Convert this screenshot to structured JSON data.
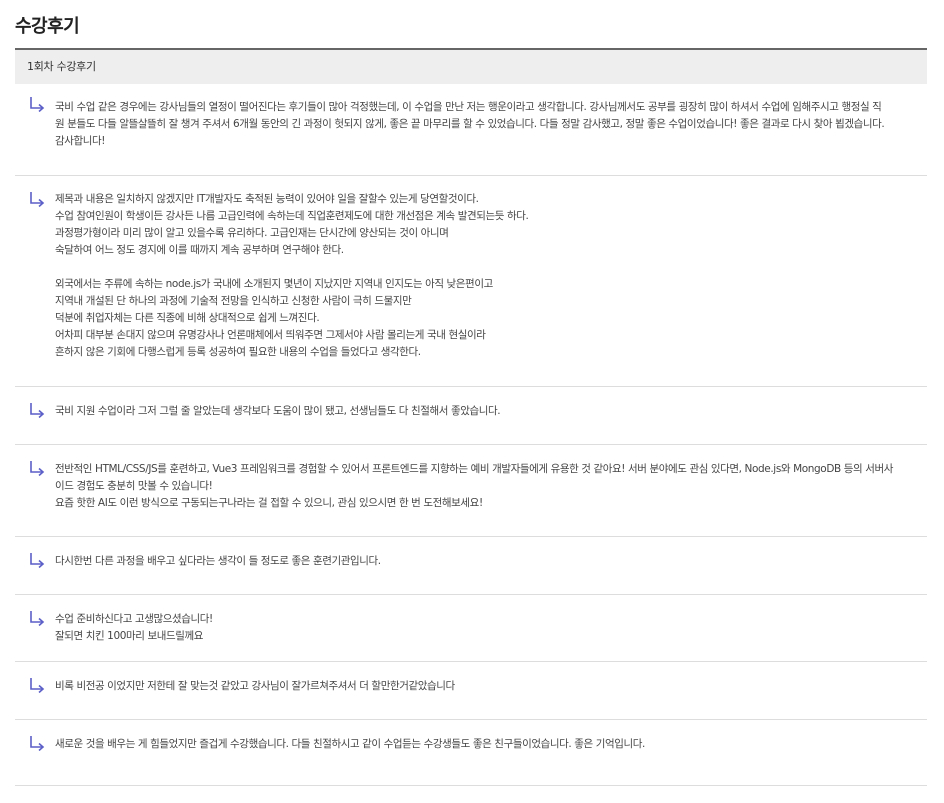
{
  "page": {
    "title": "수강후기"
  },
  "section": {
    "header": "1회차 수강후기"
  },
  "colors": {
    "arrow": "#5b5fc7",
    "header_bg": "#eeeeee",
    "divider": "#dddddd"
  },
  "reviews": [
    {
      "icon": "reply-arrow-icon",
      "lines": [
        "국비 수업 같은 경우에는 강사님들의 열정이 떨어진다는 후기들이 많아 걱정했는데, 이 수업을 만난 저는 행운이라고 생각합니다. 강사님께서도 공부를 굉장히 많이 하셔서 수업에 임해주시고 행정실 직",
        "원 분들도 다들 알뜰살뜰히 잘 챙겨 주셔서 6개월 동안의 긴 과정이 헛되지 않게, 좋은 끝 마무리를 할 수 있었습니다. 다들 정말 감사했고, 정말 좋은 수업이었습니다! 좋은 결과로 다시 찾아 뵙겠습니다.",
        "감사합니다!"
      ]
    },
    {
      "icon": "reply-arrow-icon",
      "lines": [
        "제목과 내용은 일치하지 않겠지만 IT개발자도 축적된 능력이 있어야 일을 잘할수 있는게 당연할것이다.",
        "수업 참여인원이 학생이든 강사든 나름 고급인력에 속하는데 직업훈련제도에 대한 개선점은 계속 발견되는듯 하다.",
        "과정평가형이라 미리 많이 알고 있을수록 유리하다. 고급인재는 단시간에 양산되는 것이 아니며",
        "숙달하여 어느 정도 경지에 이를 때까지 계속 공부하며 연구해야 한다.",
        "",
        "외국에서는 주류에 속하는 node.js가 국내에 소개된지 몇년이 지났지만 지역내 인지도는 아직 낮은편이고",
        "지역내 개설된 단 하나의 과정에 기술적 전망을 인식하고 신청한 사람이 극히 드물지만",
        "덕분에 취업자체는 다른 직종에 비해 상대적으로 쉽게 느껴진다.",
        "어차피 대부분 손대지 않으며 유명강사나 언론매체에서 띄워주면 그제서야 사람 몰리는게 국내 현실이라",
        "흔하지 않은 기회에 다행스럽게 등록 성공하여 필요한 내용의 수업을 들었다고 생각한다."
      ]
    },
    {
      "icon": "reply-arrow-icon",
      "lines": [
        "국비 지원 수업이라 그저 그럴 줄 알았는데 생각보다 도움이 많이 됐고, 선생님들도 다 친절해서 좋았습니다."
      ]
    },
    {
      "icon": "reply-arrow-icon",
      "lines": [
        "전반적인 HTML/CSS/JS를 훈련하고, Vue3 프레임워크를 경험할 수 있어서 프론트엔드를 지향하는 예비 개발자들에게 유용한 것 같아요! 서버 분야에도 관심 있다면, Node.js와 MongoDB 등의 서버사",
        "이드 경험도 충분히 맛볼 수 있습니다!",
        "요즘 핫한 AI도 이런 방식으로 구동되는구나라는 걸 접할 수 있으니, 관심 있으시면 한 번 도전해보세요!"
      ]
    },
    {
      "icon": "reply-arrow-icon",
      "lines": [
        "다시한번 다른 과정을 배우고 싶다라는 생각이 들 정도로 좋은 훈련기관입니다."
      ]
    },
    {
      "icon": "reply-arrow-icon",
      "lines": [
        "수업 준비하신다고 고생많으셨습니다!",
        "잘되면 치킨 100마리 보내드릴께요"
      ]
    },
    {
      "icon": "reply-arrow-icon",
      "lines": [
        "비록 비전공 이었지만 저한테 잘 맞는것 같았고 강사님이 잘가르쳐주셔서 더 할만한거같았습니다"
      ]
    },
    {
      "icon": "reply-arrow-icon",
      "lines": [
        "새로운 것을 배우는 게 힘들었지만 즐겁게 수강했습니다. 다들 친절하시고 같이 수업듣는 수강생들도 좋은 친구들이었습니다. 좋은 기억입니다."
      ]
    }
  ]
}
